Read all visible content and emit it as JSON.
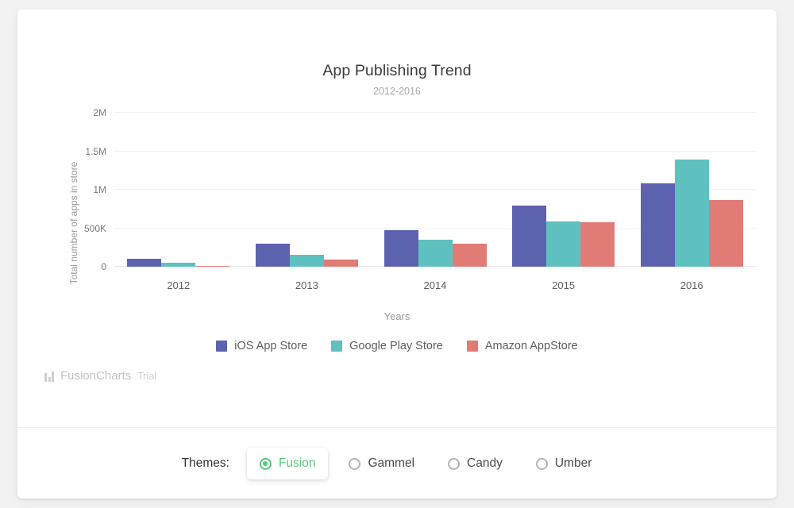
{
  "chart_data": {
    "type": "bar",
    "title": "App Publishing Trend",
    "subtitle": "2012-2016",
    "xlabel": "Years",
    "ylabel": "Total number of apps in store",
    "categories": [
      "2012",
      "2013",
      "2014",
      "2015",
      "2016"
    ],
    "series": [
      {
        "name": "iOS App Store",
        "color": "#5d62af",
        "values": [
          100000,
          295000,
          472000,
          790000,
          1080000
        ]
      },
      {
        "name": "Google Play Store",
        "color": "#5ec1bf",
        "values": [
          55000,
          150000,
          350000,
          585000,
          1390000
        ]
      },
      {
        "name": "Amazon AppStore",
        "color": "#e07b76",
        "values": [
          10000,
          88000,
          300000,
          580000,
          870000
        ]
      }
    ],
    "ylim": [
      0,
      2000000
    ],
    "yticks": [
      0,
      500000,
      1000000,
      1500000,
      2000000
    ],
    "ytick_labels": [
      "0",
      "500K",
      "1M",
      "1.5M",
      "2M"
    ],
    "grid": true,
    "legend_position": "bottom"
  },
  "watermark": {
    "brand": "FusionCharts",
    "suffix": "Trial",
    "icon": "bar-chart-icon"
  },
  "themes": {
    "label": "Themes:",
    "options": [
      {
        "name": "Fusion",
        "selected": true
      },
      {
        "name": "Gammel",
        "selected": false
      },
      {
        "name": "Candy",
        "selected": false
      },
      {
        "name": "Umber",
        "selected": false
      }
    ],
    "accent": "#55c77d"
  }
}
